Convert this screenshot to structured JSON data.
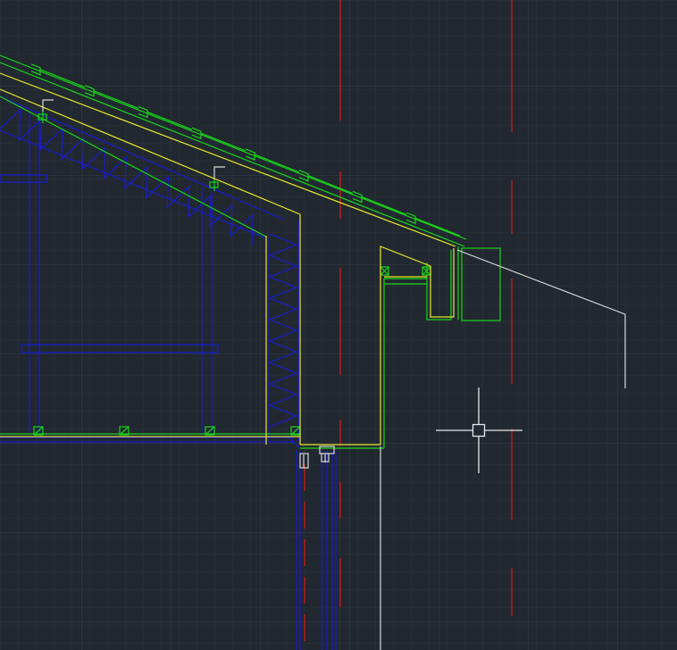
{
  "drawing": {
    "background_color": "#212830",
    "grid_minor_color": "#2a323c",
    "grid_major_color": "#343d48",
    "layers": {
      "roof_tiles": "#19d619",
      "finish_lines": "#e8e82a",
      "insulation_structure": "#1a1ad0",
      "centerlines": "#c01a1a",
      "leader_lines": "#d8d8d8"
    }
  },
  "cursor": {
    "type": "crosshair-pickbox",
    "color": "#e8e8e8"
  }
}
